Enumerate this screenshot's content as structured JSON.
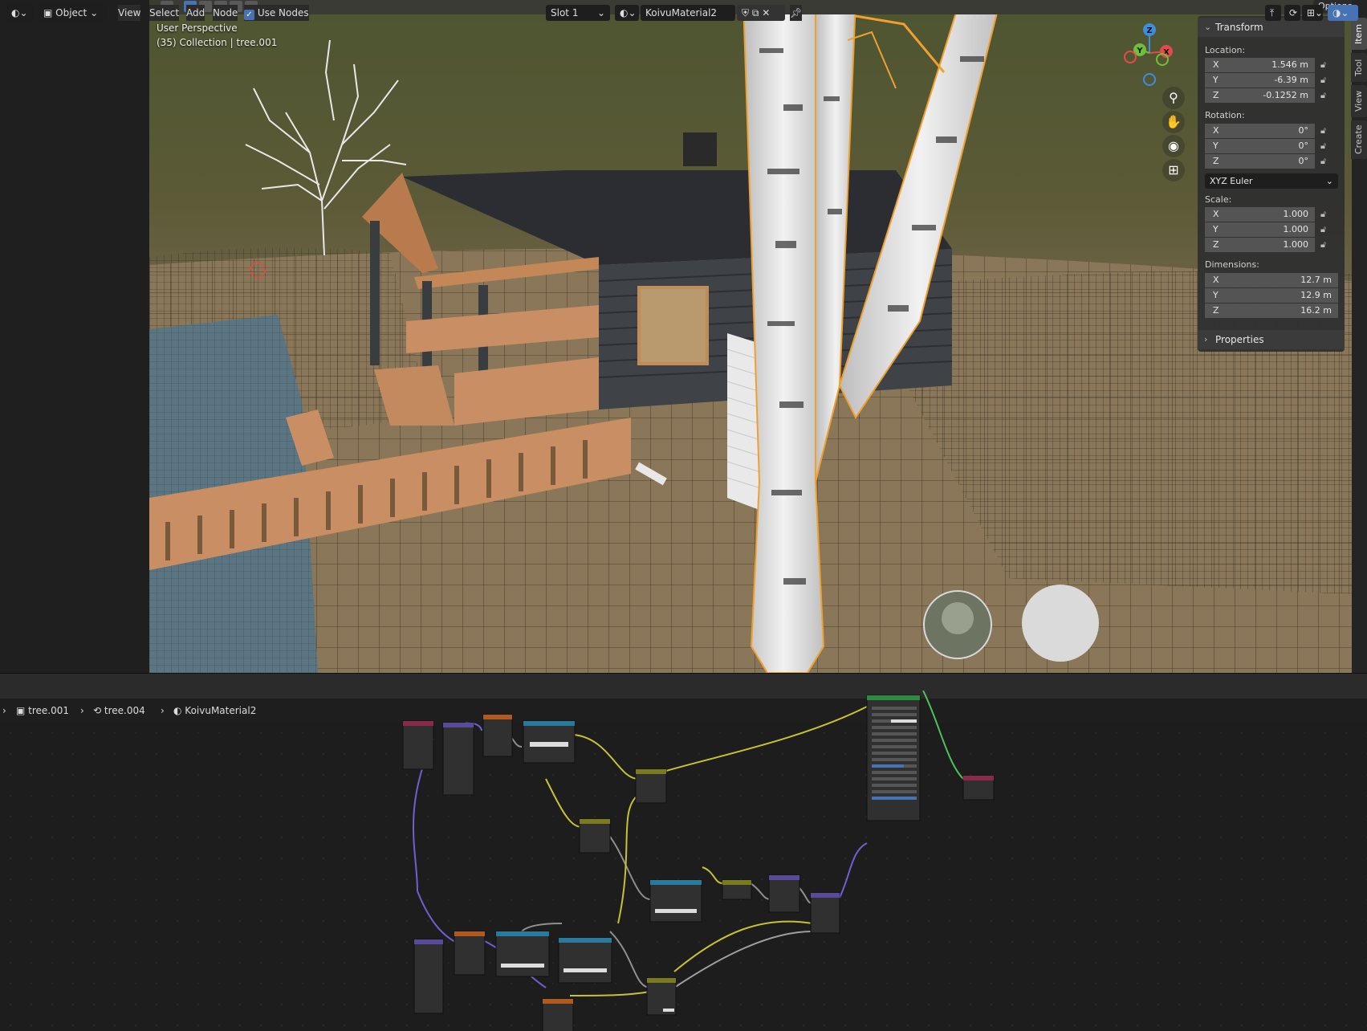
{
  "viewport": {
    "title_line1": "User Perspective",
    "title_line2": "(35) Collection | tree.001",
    "options_label": "Options"
  },
  "nav_gizmo": {
    "axes": [
      "X",
      "Y",
      "Z"
    ],
    "colors": {
      "x": "#e5484d",
      "y": "#6fbf3a",
      "z": "#3d8de0"
    }
  },
  "npanel": {
    "transform_header": "Transform",
    "location_label": "Location:",
    "location": [
      {
        "axis": "X",
        "value": "1.546 m"
      },
      {
        "axis": "Y",
        "value": "-6.39 m"
      },
      {
        "axis": "Z",
        "value": "-0.1252 m"
      }
    ],
    "rotation_label": "Rotation:",
    "rotation": [
      {
        "axis": "X",
        "value": "0°"
      },
      {
        "axis": "Y",
        "value": "0°"
      },
      {
        "axis": "Z",
        "value": "0°"
      }
    ],
    "rotation_mode": "XYZ Euler",
    "scale_label": "Scale:",
    "scale": [
      {
        "axis": "X",
        "value": "1.000"
      },
      {
        "axis": "Y",
        "value": "1.000"
      },
      {
        "axis": "Z",
        "value": "1.000"
      }
    ],
    "dimensions_label": "Dimensions:",
    "dimensions": [
      {
        "axis": "X",
        "value": "12.7 m"
      },
      {
        "axis": "Y",
        "value": "12.9 m"
      },
      {
        "axis": "Z",
        "value": "16.2 m"
      }
    ],
    "properties_header": "Properties"
  },
  "side_tabs": [
    "Item",
    "Tool",
    "View",
    "Create"
  ],
  "node_header": {
    "mode": "Object",
    "menus": [
      "View",
      "Select",
      "Add",
      "Node"
    ],
    "use_nodes_label": "Use Nodes",
    "use_nodes_checked": true,
    "slot": "Slot 1",
    "material": "KoivuMaterial2"
  },
  "breadcrumb": {
    "object": "tree.001",
    "mesh": "tree.004",
    "material": "KoivuMaterial2"
  },
  "colors": {
    "accent": "#4772b3",
    "selection_outline": "#f0a030",
    "panel_bg": "#303030"
  }
}
